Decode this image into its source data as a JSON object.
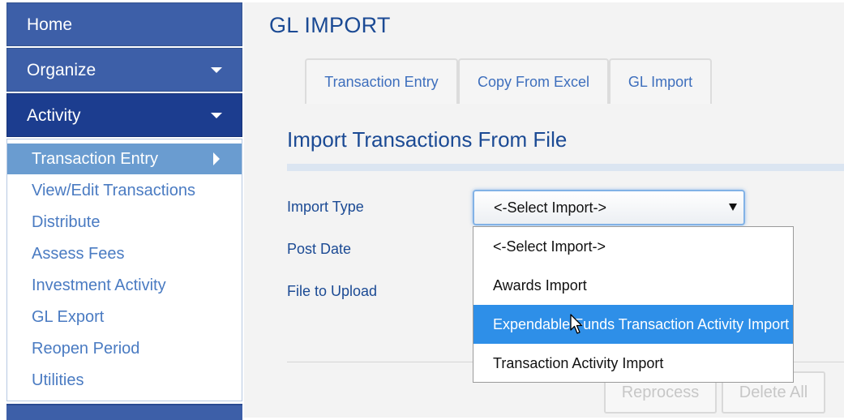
{
  "sidebar": {
    "top_items": [
      {
        "label": "Home"
      },
      {
        "label": "Organize"
      },
      {
        "label": "Activity"
      }
    ],
    "sub_items": [
      {
        "label": "Transaction Entry"
      },
      {
        "label": "View/Edit Transactions"
      },
      {
        "label": "Distribute"
      },
      {
        "label": "Assess Fees"
      },
      {
        "label": "Investment Activity"
      },
      {
        "label": "GL Export"
      },
      {
        "label": "Reopen Period"
      },
      {
        "label": "Utilities"
      }
    ]
  },
  "main": {
    "page_title": "GL IMPORT",
    "tabs": [
      {
        "label": "Transaction Entry"
      },
      {
        "label": "Copy From Excel"
      },
      {
        "label": "GL Import"
      }
    ],
    "section_title": "Import Transactions From File",
    "form": {
      "import_type_label": "Import Type",
      "post_date_label": "Post Date",
      "file_to_upload_label": "File to Upload",
      "import_type_value": "<-Select Import->"
    },
    "dropdown_options": [
      {
        "label": "<-Select Import->"
      },
      {
        "label": "Awards Import"
      },
      {
        "label": "Expendable Funds Transaction Activity Import"
      },
      {
        "label": "Transaction Activity Import"
      }
    ],
    "buttons": {
      "reprocess": "Reprocess",
      "delete_all": "Delete All"
    }
  },
  "colors": {
    "nav_blue": "#3d5fa8",
    "nav_active": "#1c3d8f",
    "submenu_active": "#6a9cd0",
    "title_blue": "#1b4a94",
    "option_highlight": "#2e8fe8"
  },
  "icons": {
    "dropdown_caret": "caret-down-icon",
    "submenu_arrow": "caret-right-icon",
    "select_arrow": "triangle-down-icon",
    "pointer": "mouse-pointer-icon"
  }
}
